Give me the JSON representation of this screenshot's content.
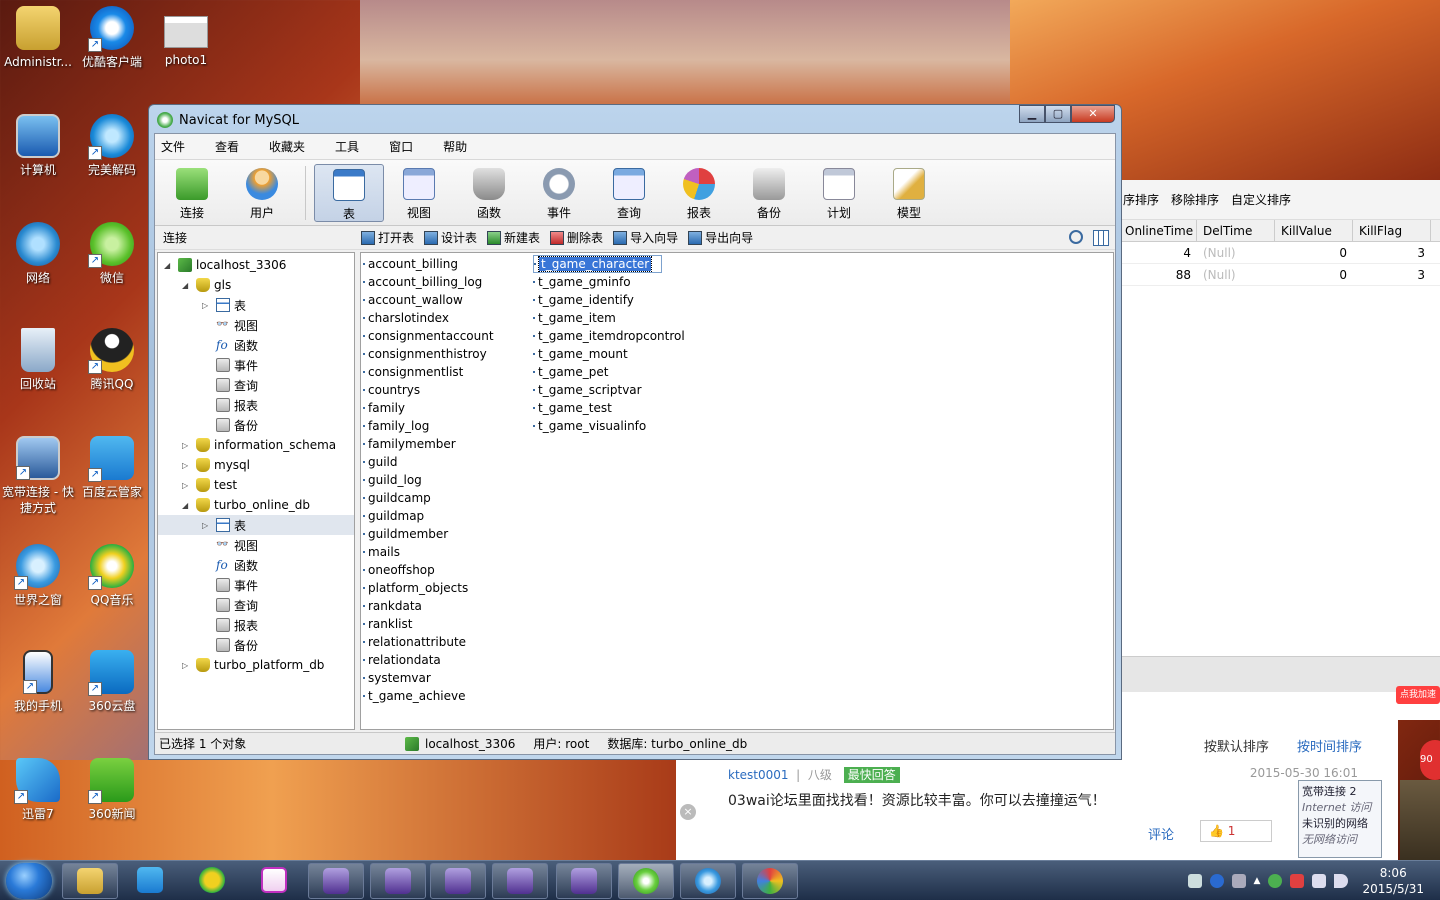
{
  "desktop": {
    "icons": [
      {
        "label": "Administr..."
      },
      {
        "label": "优酷客户端"
      },
      {
        "label": "photo1"
      },
      {
        "label": "计算机"
      },
      {
        "label": "完美解码"
      },
      {
        "label": "网络"
      },
      {
        "label": "微信"
      },
      {
        "label": "回收站"
      },
      {
        "label": "腾讯QQ"
      },
      {
        "label": "宽带连接 - 快捷方式"
      },
      {
        "label": "百度云管家"
      },
      {
        "label": "世界之窗"
      },
      {
        "label": "QQ音乐"
      },
      {
        "label": "我的手机"
      },
      {
        "label": "360云盘"
      },
      {
        "label": "迅雷7"
      },
      {
        "label": "360新闻"
      }
    ]
  },
  "bgwin": {
    "toolbar": [
      "序排序",
      "移除排序",
      "自定义排序"
    ],
    "columns": [
      "OnlineTime",
      "DelTime",
      "KillValue",
      "KillFlag"
    ],
    "rows": [
      [
        "4",
        "(Null)",
        "0",
        "3"
      ],
      [
        "88",
        "(Null)",
        "0",
        "3"
      ]
    ]
  },
  "forum": {
    "sort_default": "按默认排序",
    "sort_time": "按时间排序",
    "user": "ktest0001",
    "level": "八级",
    "badge": "最快回答",
    "date": "2015-05-30 16:01",
    "text": "03wai论坛里面找找看！资源比较丰富。你可以去撞撞运气！",
    "comment": "评论",
    "likes": "1"
  },
  "netpop": {
    "line1": "宽带连接  2",
    "line2": "Internet 访问",
    "line3": "未识别的网络",
    "line4": "无网络访问"
  },
  "speed": "点我加速",
  "redball": "90",
  "window": {
    "title": "Navicat for MySQL",
    "menu": [
      "文件",
      "查看",
      "收藏夹",
      "工具",
      "窗口",
      "帮助"
    ],
    "toolbar": [
      {
        "label": "连接",
        "color": "#5cba47"
      },
      {
        "label": "用户",
        "color": "#f0a030"
      },
      {
        "label": "表",
        "color": "#3a7ac8"
      },
      {
        "label": "视图",
        "color": "#6a8ac8"
      },
      {
        "label": "函数",
        "color": "#d08030"
      },
      {
        "label": "事件",
        "color": "#8a9ab0"
      },
      {
        "label": "查询",
        "color": "#5a8ac0"
      },
      {
        "label": "报表",
        "color": "#c060c0"
      },
      {
        "label": "备份",
        "color": "#707070"
      },
      {
        "label": "计划",
        "color": "#909aa8"
      },
      {
        "label": "模型",
        "color": "#e0b040"
      }
    ],
    "connection_label": "连接",
    "actions": [
      "打开表",
      "设计表",
      "新建表",
      "删除表",
      "导入向导",
      "导出向导"
    ],
    "tree": {
      "server": "localhost_3306",
      "gls": "gls",
      "children": [
        "表",
        "视图",
        "函数",
        "事件",
        "查询",
        "报表",
        "备份"
      ],
      "dbs": [
        "information_schema",
        "mysql",
        "test",
        "turbo_online_db",
        "turbo_platform_db"
      ]
    },
    "tables_col1": [
      "account_billing",
      "account_billing_log",
      "account_wallow",
      "charslotindex",
      "consignmentaccount",
      "consignmenthistroy",
      "consignmentlist",
      "countrys",
      "family",
      "family_log",
      "familymember",
      "guild",
      "guild_log",
      "guildcamp",
      "guildmap",
      "guildmember",
      "mails",
      "oneoffshop",
      "platform_objects",
      "rankdata",
      "ranklist",
      "relationattribute",
      "relationdata",
      "systemvar",
      "t_game_achieve"
    ],
    "tables_col2": [
      "t_game_character",
      "t_game_gminfo",
      "t_game_identify",
      "t_game_item",
      "t_game_itemdropcontrol",
      "t_game_mount",
      "t_game_pet",
      "t_game_scriptvar",
      "t_game_test",
      "t_game_visualinfo"
    ],
    "status": {
      "selected": "已选择 1 个对象",
      "server": "localhost_3306",
      "user": "用户: root",
      "database": "数据库: turbo_online_db"
    }
  },
  "taskbar": {
    "time": "8:06",
    "date": "2015/5/31"
  }
}
